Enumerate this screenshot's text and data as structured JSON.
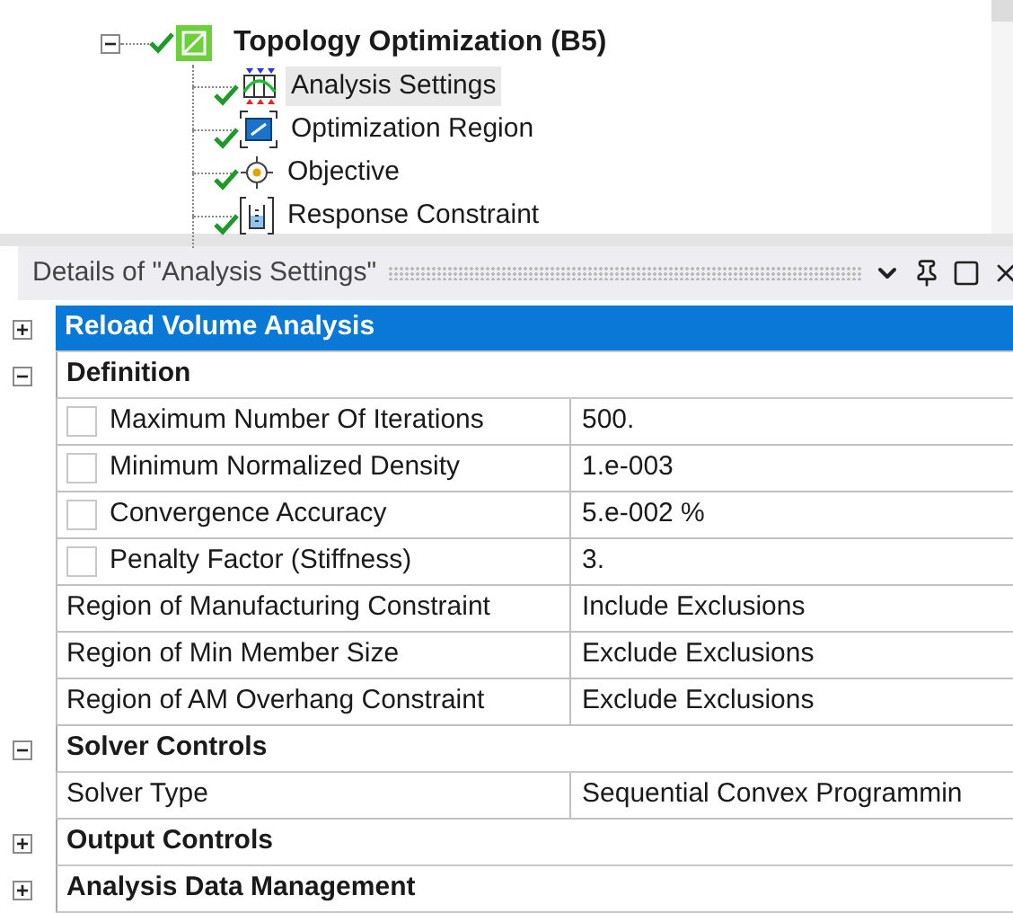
{
  "tree": {
    "label": "Topology Optimization (B5)",
    "expanded": true,
    "children": [
      {
        "label": "Analysis Settings",
        "kind": "settings",
        "selected": true
      },
      {
        "label": "Optimization Region",
        "kind": "region",
        "selected": false
      },
      {
        "label": "Objective",
        "kind": "objective",
        "selected": false
      },
      {
        "label": "Response Constraint",
        "kind": "constraint",
        "selected": false
      }
    ]
  },
  "details": {
    "title": "Details of \"Analysis Settings\"",
    "groups": [
      {
        "label": "Reload Volume Analysis",
        "expanded": false,
        "selected": true
      },
      {
        "label": "Definition",
        "expanded": true,
        "selected": false,
        "rows": [
          {
            "kind": "checkbox",
            "checked": false,
            "label": "Maximum Number Of Iterations",
            "value": "500."
          },
          {
            "kind": "checkbox",
            "checked": false,
            "label": "Minimum Normalized Density",
            "value": "1.e-003"
          },
          {
            "kind": "checkbox",
            "checked": false,
            "label": "Convergence Accuracy",
            "value": "5.e-002 %"
          },
          {
            "kind": "checkbox",
            "checked": false,
            "label": "Penalty Factor (Stiffness)",
            "value": "3."
          },
          {
            "kind": "plain",
            "label": "Region of Manufacturing Constraint",
            "value": "Include Exclusions"
          },
          {
            "kind": "plain",
            "label": "Region of Min Member Size",
            "value": "Exclude Exclusions"
          },
          {
            "kind": "plain",
            "label": "Region of AM Overhang Constraint",
            "value": "Exclude Exclusions"
          }
        ]
      },
      {
        "label": "Solver Controls",
        "expanded": true,
        "selected": false,
        "rows": [
          {
            "kind": "plain",
            "label": "Solver Type",
            "value": "Sequential Convex Programmin"
          }
        ]
      },
      {
        "label": "Output Controls",
        "expanded": false,
        "selected": false
      },
      {
        "label": "Analysis Data Management",
        "expanded": false,
        "selected": false
      }
    ]
  }
}
